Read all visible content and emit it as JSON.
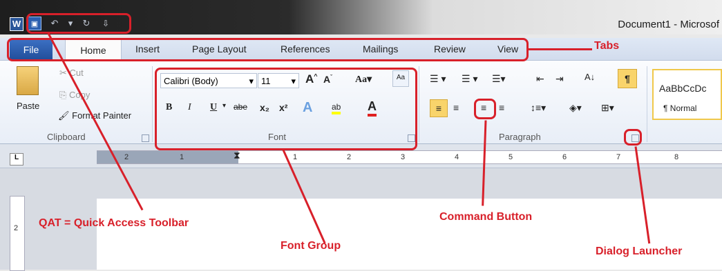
{
  "app": {
    "icon_letter": "W",
    "doc_title": "Document1 - Microsof"
  },
  "qat": {
    "undo": "↶",
    "undo_drop": "▾",
    "redo": "↻",
    "customize": "⇩"
  },
  "tabs": [
    "File",
    "Home",
    "Insert",
    "Page Layout",
    "References",
    "Mailings",
    "Review",
    "View"
  ],
  "clipboard": {
    "paste": "Paste",
    "cut": "Cut",
    "copy": "Copy",
    "format_painter": "Format Painter",
    "label": "Clipboard"
  },
  "font": {
    "family": "Calibri (Body)",
    "size": "11",
    "label": "Font",
    "bold": "B",
    "italic": "I",
    "underline": "U",
    "strike": "abe",
    "sub": "x₂",
    "sup": "x²",
    "change_case": "Aa"
  },
  "paragraph": {
    "label": "Paragraph",
    "pilcrow": "¶"
  },
  "styles": {
    "preview": "AaBbCcDc",
    "name": "¶ Normal"
  },
  "ruler": {
    "ticks": [
      "2",
      "1",
      "1",
      "2",
      "3",
      "4",
      "5",
      "6",
      "7",
      "8"
    ],
    "tab_selector": "L"
  },
  "vruler": {
    "ticks": [
      "2"
    ]
  },
  "annotations": {
    "tabs": "Tabs",
    "qat": "QAT = Quick Access Toolbar",
    "command_button": "Command Button",
    "font_group": "Font Group",
    "dialog_launcher": "Dialog Launcher"
  }
}
